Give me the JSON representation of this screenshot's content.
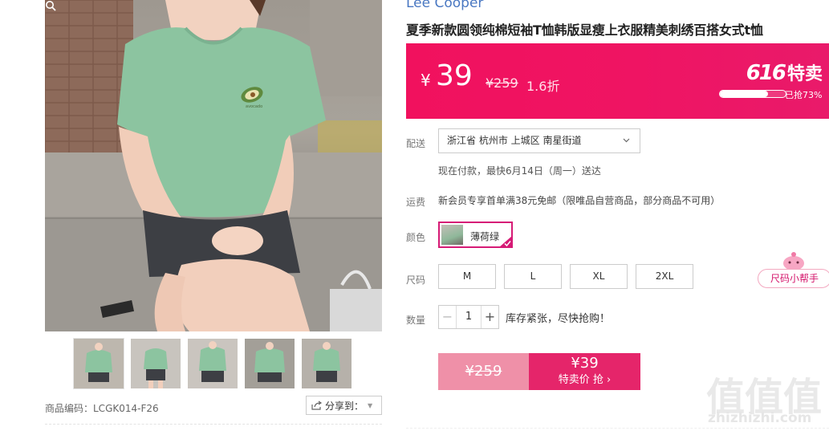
{
  "product": {
    "brand": "Lee Cooper",
    "title": "夏季新款圆领纯棉短袖T恤韩版显瘦上衣服精美刺绣百搭女式t恤",
    "sku_code": "商品编码：LCGK014-F26"
  },
  "share": {
    "label": "分享到："
  },
  "price": {
    "currency": "¥",
    "current": "39",
    "original": "¥259",
    "discount": "1.6折"
  },
  "promo": {
    "num": "616",
    "label": "特卖",
    "progress_text": "已抢73%",
    "progress_fraction": 0.73,
    "brand_color": "#ef1463"
  },
  "delivery": {
    "label": "配送",
    "address": "浙江省 杭州市 上城区 南星街道",
    "note": "现在付款，最快6月14日（周一）送达"
  },
  "shipping": {
    "label": "运费",
    "text": "新会员专享首单满38元免邮（限唯品自营商品，部分商品不可用）"
  },
  "color": {
    "label": "颜色",
    "selected": "薄荷绿"
  },
  "size": {
    "label": "尺码",
    "options": [
      "M",
      "L",
      "XL",
      "2XL"
    ]
  },
  "quantity": {
    "label": "数量",
    "value": "1",
    "stock_note": "库存紧张，尽快抢购！"
  },
  "buy": {
    "original": "¥259",
    "price": "¥39",
    "action": "特卖价 抢 ›"
  },
  "size_helper": {
    "label": "尺码小帮手"
  },
  "watermark": {
    "glyphs": "值值值",
    "domain": "zhizhizhi.com"
  },
  "icons": [
    "zoom-icon",
    "share-icon",
    "chevron-down-icon",
    "check-icon",
    "mascot-icon"
  ]
}
